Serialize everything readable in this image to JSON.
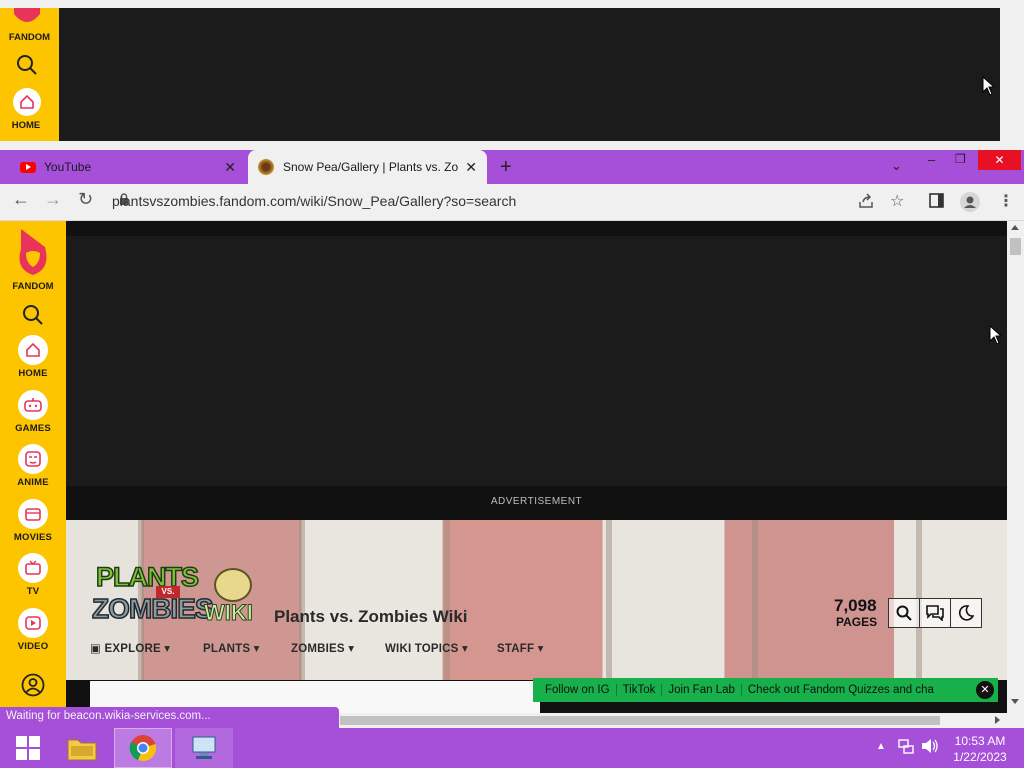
{
  "background_window": {
    "rail_items": [
      {
        "label": "FANDOM",
        "icon": "fandom-logo-icon"
      },
      {
        "label": "",
        "icon": "search-icon"
      },
      {
        "label": "HOME",
        "icon": "home-icon"
      }
    ]
  },
  "browser": {
    "tabs": [
      {
        "title": "YouTube",
        "icon": "youtube-icon"
      },
      {
        "title": "Snow Pea/Gallery | Plants vs. Zom",
        "icon": "pvz-favicon",
        "active": true
      }
    ],
    "new_tab_label": "+",
    "url": "plantsvszombies.fandom.com/wiki/Snow_Pea/Gallery?so=search",
    "window_buttons": {
      "minimize": "–",
      "restore": "❐",
      "close": "✕"
    }
  },
  "fandom_rail": {
    "brand": "FANDOM",
    "items": [
      {
        "label": "HOME",
        "icon": "home-icon"
      },
      {
        "label": "GAMES",
        "icon": "gamepad-icon"
      },
      {
        "label": "ANIME",
        "icon": "anime-icon"
      },
      {
        "label": "MOVIES",
        "icon": "clapperboard-icon"
      },
      {
        "label": "TV",
        "icon": "tv-icon"
      },
      {
        "label": "VIDEO",
        "icon": "video-icon"
      }
    ]
  },
  "page": {
    "ad_label": "ADVERTISEMENT",
    "logo_text_1": "PLANTS",
    "logo_text_vs": "VS.",
    "logo_text_2": "ZOMBIES",
    "logo_text_wiki": "WIKI",
    "wiki_title": "Plants vs. Zombies Wiki",
    "pages_count": "7,098",
    "pages_label": "PAGES",
    "nav": [
      {
        "label": "EXPLORE"
      },
      {
        "label": "PLANTS"
      },
      {
        "label": "ZOMBIES"
      },
      {
        "label": "WIKI TOPICS"
      },
      {
        "label": "STAFF"
      }
    ],
    "promo_links": [
      "Follow on IG",
      "TikTok",
      "Join Fan Lab",
      "Check out Fandom Quizzes and cha"
    ]
  },
  "status_text": "Waiting for beacon.wikia-services.com...",
  "taskbar": {
    "time": "10:53 AM",
    "date": "1/22/2023"
  },
  "colors": {
    "fandom_yellow": "#fcc500",
    "fandom_pink": "#e8345a",
    "chrome_purple": "#a64fd9",
    "promo_green": "#18b04a"
  }
}
